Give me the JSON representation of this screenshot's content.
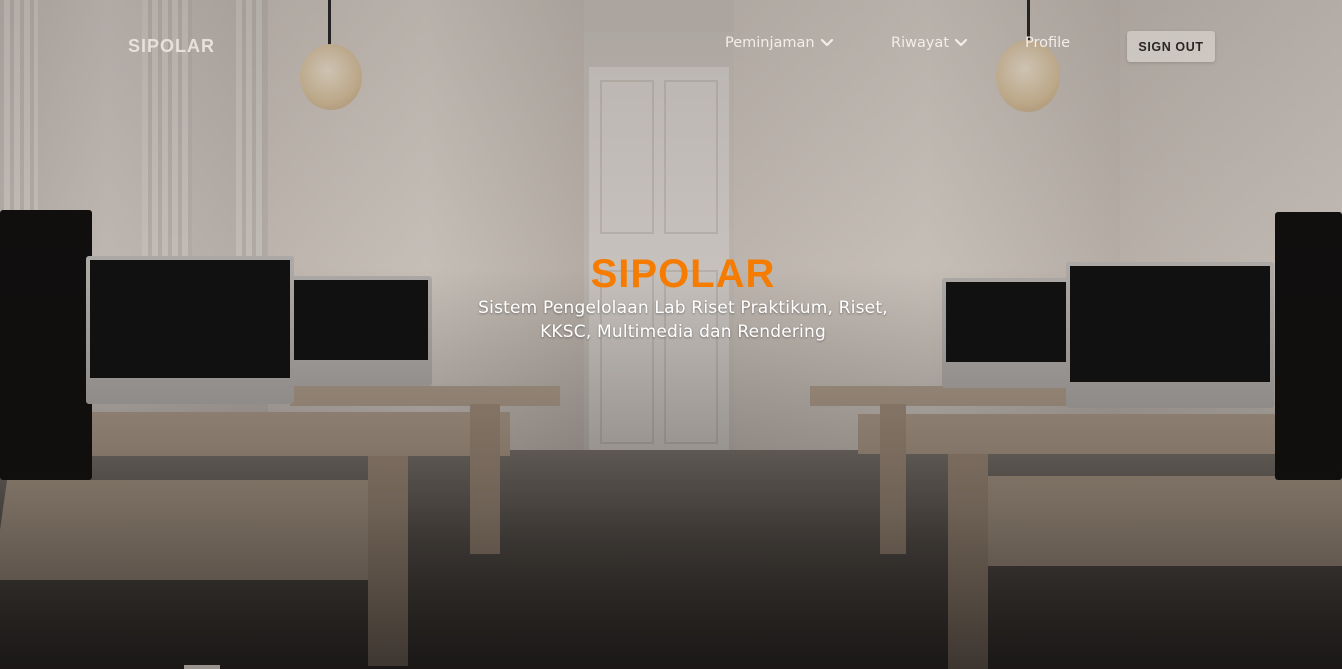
{
  "navbar": {
    "brand": "SIPOLAR",
    "items": [
      {
        "label": "Peminjaman",
        "has_dropdown": true,
        "icon": "chevron-down-icon"
      },
      {
        "label": "Riwayat",
        "has_dropdown": true,
        "icon": "chevron-down-icon"
      },
      {
        "label": "Profile",
        "has_dropdown": false
      }
    ],
    "signout_label": "SIGN OUT"
  },
  "hero": {
    "logo_text": "SIPOLAR",
    "logo_color": "#f57c00",
    "tagline": "Sistem Pengelolaan Lab Riset Praktikum, Riset, KKSC, Multimedia dan Rendering"
  }
}
